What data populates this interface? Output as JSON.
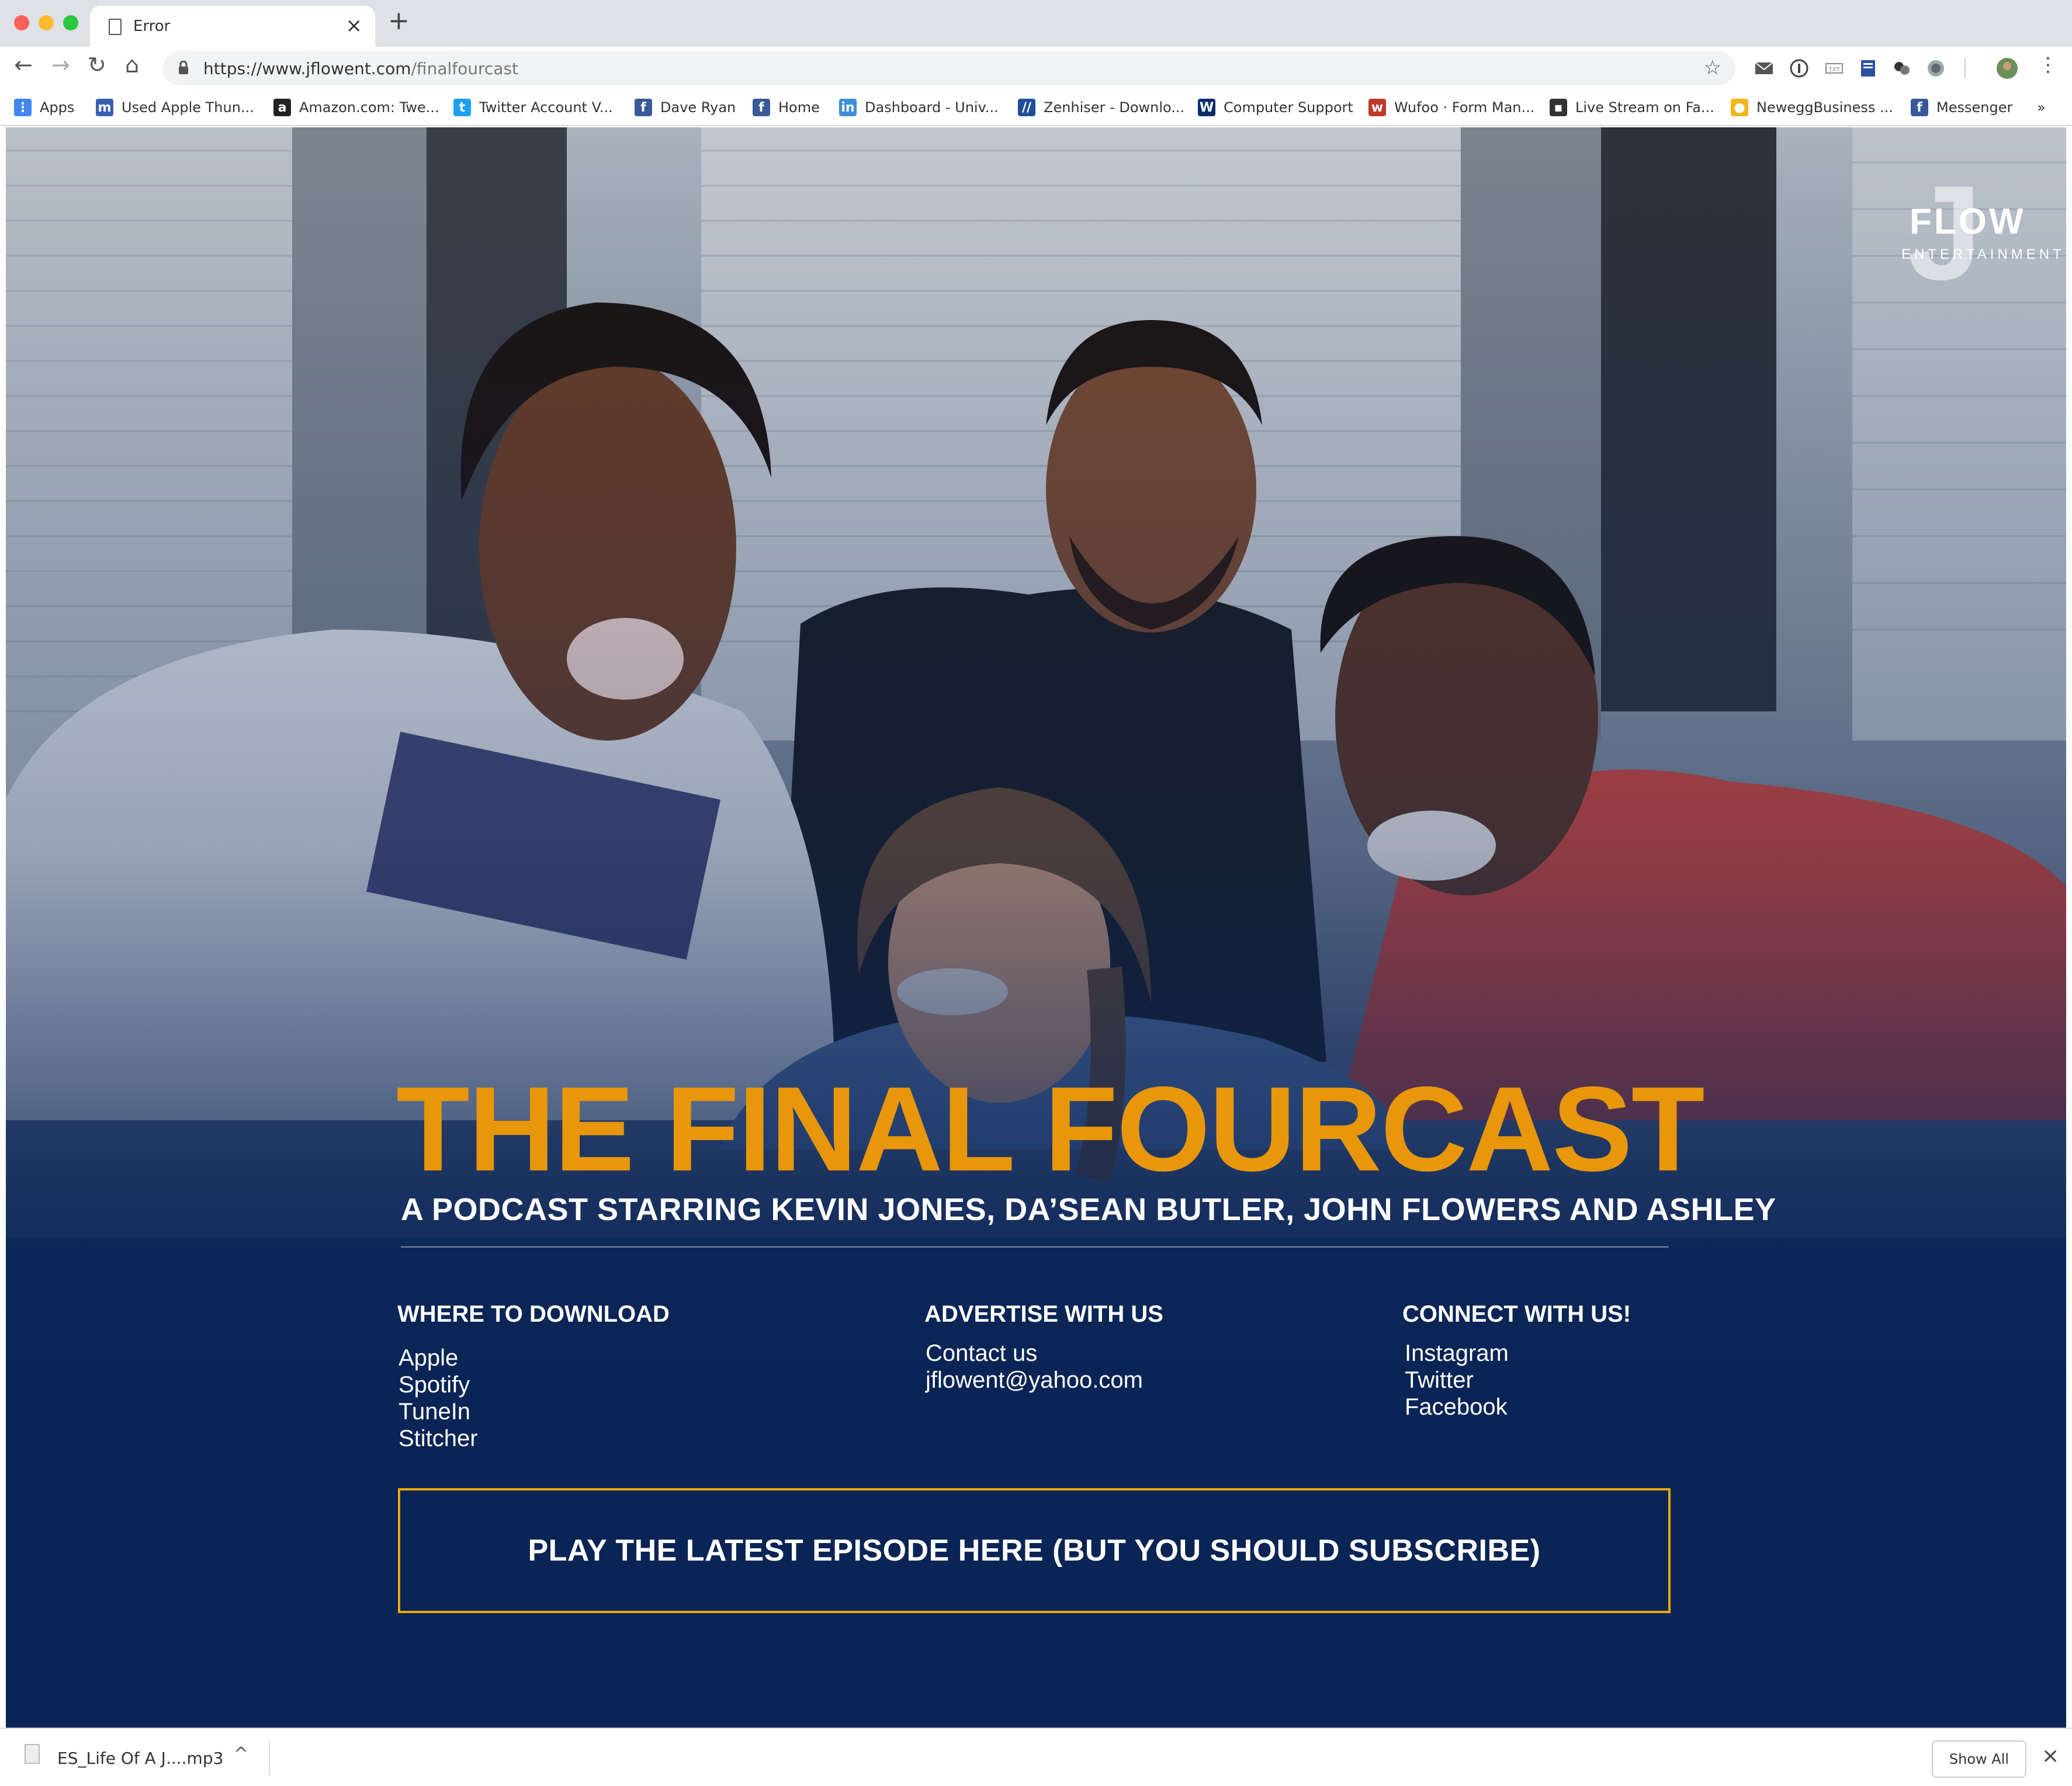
{
  "browser": {
    "tab_title": "Error",
    "new_tab": "+",
    "tab_close": "×",
    "url_host": "https://www.jflowent.com",
    "url_path": "/finalfourcast",
    "bookmarks": [
      {
        "label": "Apps",
        "icon": "apps-grid-icon",
        "color": "#4285f4",
        "glyph": "⋮"
      },
      {
        "label": "Used Apple Thun...",
        "icon": "m-icon",
        "color": "#3a5fb5",
        "glyph": "m"
      },
      {
        "label": "Amazon.com: Twe...",
        "icon": "amazon-icon",
        "color": "#222222",
        "glyph": "a"
      },
      {
        "label": "Twitter Account V...",
        "icon": "twitter-icon",
        "color": "#1da1f2",
        "glyph": "t"
      },
      {
        "label": "Dave Ryan",
        "icon": "facebook-icon",
        "color": "#3b5998",
        "glyph": "f"
      },
      {
        "label": "Home",
        "icon": "facebook-icon",
        "color": "#3b5998",
        "glyph": "f"
      },
      {
        "label": "Dashboard - Univ...",
        "icon": "dashboard-icon",
        "color": "#3d8fd6",
        "glyph": "in"
      },
      {
        "label": "Zenhiser - Downlo...",
        "icon": "zenhiser-icon",
        "color": "#1e4f9c",
        "glyph": "//"
      },
      {
        "label": "Computer Support",
        "icon": "wv-icon",
        "color": "#0b2d6b",
        "glyph": "W"
      },
      {
        "label": "Wufoo · Form Man...",
        "icon": "wufoo-icon",
        "color": "#c0392b",
        "glyph": "w"
      },
      {
        "label": "Live Stream on Fa...",
        "icon": "livestream-icon",
        "color": "#333333",
        "glyph": "▪"
      },
      {
        "label": "NeweggBusiness ...",
        "icon": "newegg-icon",
        "color": "#f3b61f",
        "glyph": "●"
      },
      {
        "label": "Messenger",
        "icon": "facebook-icon",
        "color": "#3b5998",
        "glyph": "f"
      }
    ],
    "bookmarks_more": "»"
  },
  "page": {
    "logo_j": "J",
    "logo_flow": "FLOW",
    "logo_ent": "ENTERTAINMENT",
    "headline": "THE FINAL FOURCAST",
    "subhead": "A PODCAST STARRING KEVIN JONES, DA’SEAN BUTLER, JOHN FLOWERS AND ASHLEY",
    "columns": {
      "download": {
        "heading": "WHERE TO DOWNLOAD",
        "links": [
          "Apple",
          "Spotify",
          "TuneIn",
          "Stitcher"
        ]
      },
      "advertise": {
        "heading": "ADVERTISE WITH US",
        "links": [
          "Contact us",
          "jflowent@yahoo.com"
        ]
      },
      "connect": {
        "heading": "CONNECT WITH US!",
        "links": [
          "Instagram",
          "Twitter",
          "Facebook"
        ]
      }
    },
    "cta": "PLAY THE LATEST EPISODE HERE (BUT YOU SHOULD SUBSCRIBE)",
    "colors": {
      "accent": "#e8970b",
      "navy": "#0a2455"
    }
  },
  "downloads": {
    "file": "ES_Life Of A J....mp3",
    "show_all": "Show All",
    "close": "×"
  }
}
